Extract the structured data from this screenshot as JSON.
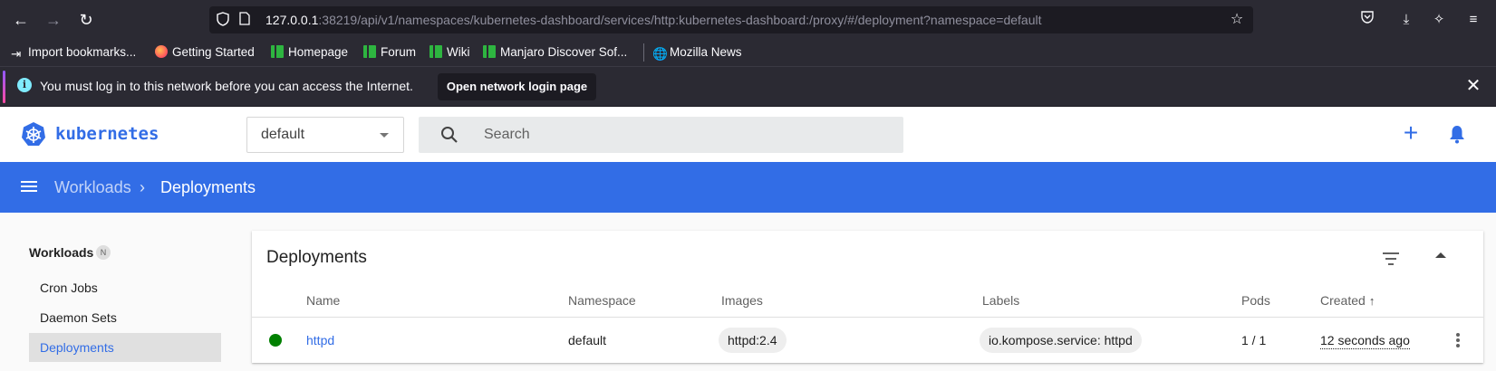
{
  "browser": {
    "url_host": "127.0.0.1",
    "url_rest": ":38219/api/v1/namespaces/kubernetes-dashboard/services/http:kubernetes-dashboard:/proxy/#/deployment?namespace=default",
    "bookmarks": [
      {
        "label": "Import bookmarks...",
        "icon": "import-icon"
      },
      {
        "label": "Getting Started",
        "icon": "firefox-icon"
      },
      {
        "label": "Homepage",
        "icon": "manjaro-icon"
      },
      {
        "label": "Forum",
        "icon": "manjaro-icon"
      },
      {
        "label": "Wiki",
        "icon": "manjaro-icon"
      },
      {
        "label": "Manjaro Discover Sof...",
        "icon": "manjaro-icon"
      },
      {
        "label": "Mozilla News",
        "icon": "globe-icon"
      }
    ],
    "notification": {
      "text": "You must log in to this network before you can access the Internet.",
      "button": "Open network login page"
    }
  },
  "app": {
    "brand": "kubernetes",
    "namespace": "default",
    "search_placeholder": "Search",
    "accent_color": "#326de6"
  },
  "breadcrumb": {
    "parent": "Workloads",
    "separator": "›",
    "current": "Deployments"
  },
  "sidebar": {
    "header": "Workloads",
    "badge": "N",
    "items": [
      {
        "label": "Cron Jobs",
        "active": false
      },
      {
        "label": "Daemon Sets",
        "active": false
      },
      {
        "label": "Deployments",
        "active": true
      }
    ]
  },
  "card": {
    "title": "Deployments",
    "columns": [
      "Name",
      "Namespace",
      "Images",
      "Labels",
      "Pods",
      "Created"
    ],
    "sort_indicator": "↑",
    "rows": [
      {
        "status_color": "#008000",
        "name": "httpd",
        "namespace": "default",
        "image": "httpd:2.4",
        "label": "io.kompose.service: httpd",
        "pods": "1 / 1",
        "created": "12 seconds ago"
      }
    ]
  }
}
